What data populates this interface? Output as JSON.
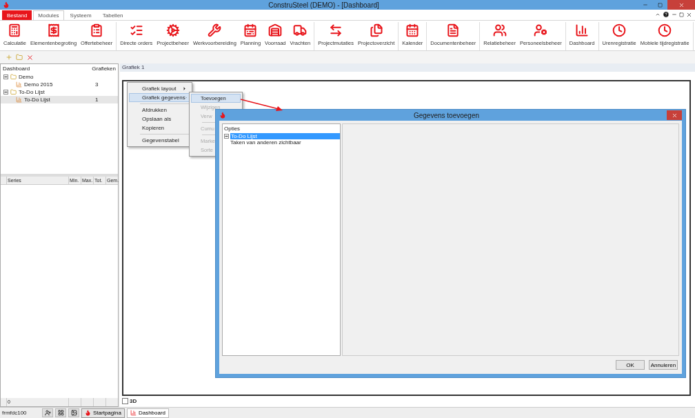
{
  "window": {
    "title": "ConstruSteel (DEMO) - [Dashboard]"
  },
  "menu_tabs": [
    {
      "label": "Bestand",
      "kind": "file",
      "selected": false
    },
    {
      "label": "Modules",
      "kind": "tab",
      "selected": true
    },
    {
      "label": "Systeem",
      "kind": "tab",
      "selected": false
    },
    {
      "label": "Tabellen",
      "kind": "tab",
      "selected": false
    }
  ],
  "ribbon": {
    "groups": [
      {
        "items": [
          "Calculatie",
          "Elementenbegroting",
          "Offertebeheer"
        ]
      },
      {
        "items": [
          "Directe orders",
          "Projectbeheer",
          "Werkvoorbereiding",
          "Planning",
          "Voorraad",
          "Vrachten"
        ]
      },
      {
        "items": [
          "Projectmutaties",
          "Projectoverzicht"
        ]
      },
      {
        "items": [
          "Kalender"
        ]
      },
      {
        "items": [
          "Documentenbeheer"
        ]
      },
      {
        "items": [
          "Relatiebeheer",
          "Personeelsbeheer"
        ]
      },
      {
        "items": [
          "Dashboard"
        ]
      },
      {
        "items": [
          "Urenregistratie",
          "Mobiele tijdregistratie"
        ]
      }
    ]
  },
  "tree": {
    "columns": [
      "Dashboard",
      "Grafieken"
    ],
    "items": [
      {
        "label": "Demo",
        "expanded": true,
        "selected": false,
        "children": [
          {
            "label": "Demo 2015",
            "count": "3",
            "selected": false
          }
        ]
      },
      {
        "label": "To-Do Lijst",
        "expanded": true,
        "selected": false,
        "children": [
          {
            "label": "To-Do Lijst",
            "count": "1",
            "selected": true
          }
        ]
      }
    ]
  },
  "series_table": {
    "columns": [
      "Series",
      "Min.",
      "Max.",
      "Tot.",
      "Gem."
    ],
    "footer": "0"
  },
  "chart_tab": {
    "title": "Grafiek 1"
  },
  "option_3d": {
    "label": "3D",
    "checked": false
  },
  "context_menu": {
    "groups": [
      [
        {
          "label": "Grafiek layout",
          "submenu": true,
          "selected": false
        },
        {
          "label": "Grafiek gegevens",
          "submenu": true,
          "selected": true
        }
      ],
      [
        {
          "label": "Afdrukken",
          "submenu": false,
          "selected": false
        },
        {
          "label": "Opslaan als",
          "submenu": false,
          "selected": false
        },
        {
          "label": "Kopieren",
          "submenu": false,
          "selected": false
        }
      ],
      [
        {
          "label": "Gegevenstabel",
          "submenu": false,
          "selected": false
        }
      ]
    ]
  },
  "submenu": {
    "groups": [
      [
        {
          "label": "Toevoegen",
          "selected": true,
          "disabled": false
        },
        {
          "label": "Wijzigen",
          "selected": false,
          "disabled": true
        },
        {
          "label": "Verw",
          "selected": false,
          "disabled": true
        }
      ],
      [
        {
          "label": "Cumu",
          "selected": false,
          "disabled": true
        }
      ],
      [
        {
          "label": "Marke",
          "selected": false,
          "disabled": true
        },
        {
          "label": "Sorte",
          "selected": false,
          "disabled": true
        }
      ]
    ]
  },
  "dialog": {
    "title": "Gegevens toevoegen",
    "options_header": "Opties",
    "options": [
      {
        "label": "To-Do Lijst",
        "expanded": true,
        "selected": true,
        "children": [
          {
            "label": "Taken van anderen zichtbaar",
            "selected": false
          }
        ]
      }
    ],
    "buttons": [
      "OK",
      "Annuleren"
    ]
  },
  "status_bar": {
    "form": "frmfdc100",
    "tabs": [
      {
        "label": "Startpagina",
        "selected": false
      },
      {
        "label": "Dashboard",
        "selected": true
      }
    ]
  }
}
